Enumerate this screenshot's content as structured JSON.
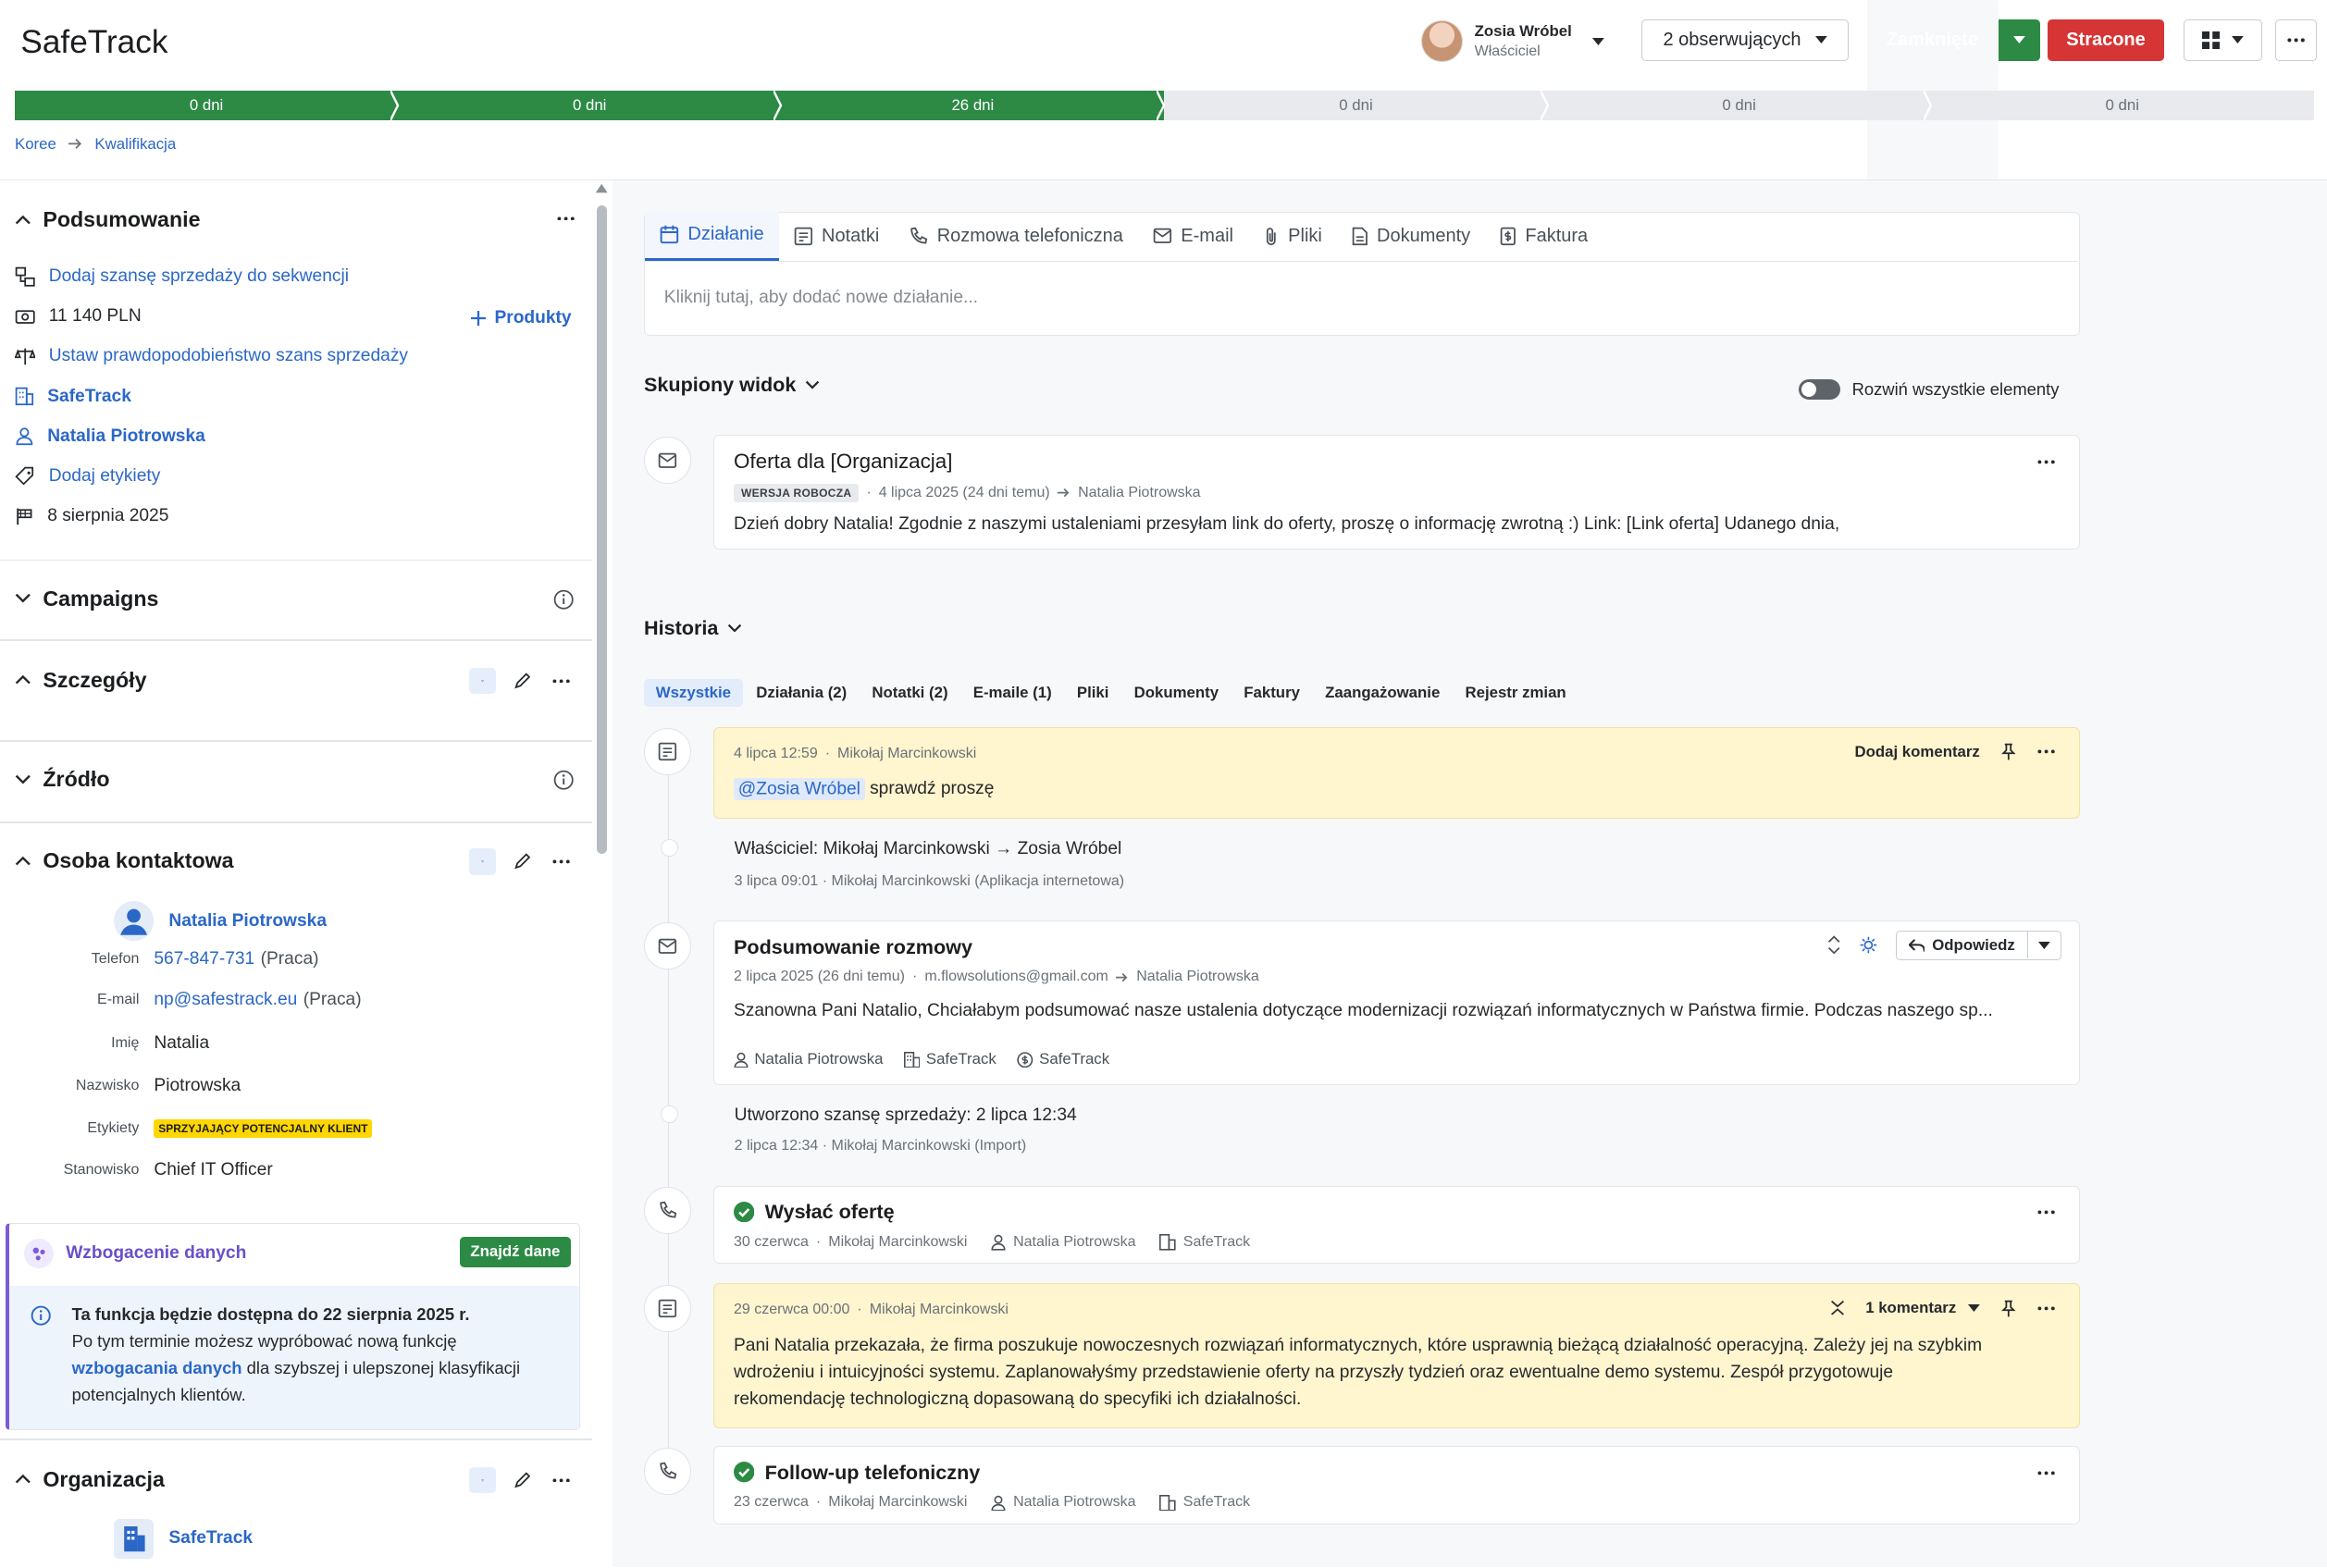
{
  "header": {
    "app_title": "SafeTrack",
    "owner_name": "Zosia Wróbel",
    "owner_role": "Właściciel",
    "watchers_label": "2 obserwujących",
    "won_label": "Zamknięte",
    "lost_label": "Stracone"
  },
  "pipeline": {
    "stages": [
      {
        "label": "0 dni",
        "state": "done"
      },
      {
        "label": "0 dni",
        "state": "done"
      },
      {
        "label": "26 dni",
        "state": "done"
      },
      {
        "label": "0 dni",
        "state": "todo"
      },
      {
        "label": "0 dni",
        "state": "todo"
      },
      {
        "label": "0 dni",
        "state": "todo"
      }
    ]
  },
  "breadcrumb": {
    "pipeline": "Koree",
    "stage": "Kwalifikacja"
  },
  "sidebar": {
    "summary": {
      "title": "Podsumowanie",
      "add_sequence": "Dodaj szansę sprzedaży do sekwencji",
      "value": "11 140 PLN",
      "products": "Produkty",
      "probability": "Ustaw prawdopodobieństwo szans sprzedaży",
      "organization": "SafeTrack",
      "person": "Natalia Piotrowska",
      "labels": "Dodaj etykiety",
      "close_date": "8 sierpnia 2025"
    },
    "campaigns_title": "Campaigns",
    "details_title": "Szczegóły",
    "source_title": "Źródło",
    "contact": {
      "title": "Osoba kontaktowa",
      "name": "Natalia Piotrowska",
      "phone_label": "Telefon",
      "phone": "567-847-731",
      "phone_type": "(Praca)",
      "email_label": "E-mail",
      "email": "np@safestrack.eu",
      "email_type": "(Praca)",
      "first_name_label": "Imię",
      "first_name": "Natalia",
      "last_name_label": "Nazwisko",
      "last_name": "Piotrowska",
      "tags_label": "Etykiety",
      "tag": "SPRZYJAJĄCY POTENCJALNY KLIENT",
      "position_label": "Stanowisko",
      "position": "Chief IT Officer"
    },
    "enrichment": {
      "title": "Wzbogacenie danych",
      "button": "Znajdź dane",
      "headline": "Ta funkcja będzie dostępna do 22 sierpnia 2025 r.",
      "text_before": "Po tym terminie możesz wypróbować nową funkcję",
      "link": "wzbogacania danych",
      "text_after": " dla szybszej i ulepszonej klasyfikacji potencjalnych klientów."
    },
    "organization": {
      "title": "Organizacja",
      "name": "SafeTrack"
    }
  },
  "composer": {
    "tabs": [
      "Działanie",
      "Notatki",
      "Rozmowa telefoniczna",
      "E-mail",
      "Pliki",
      "Dokumenty",
      "Faktura"
    ],
    "placeholder": "Kliknij tutaj, aby dodać nowe działanie..."
  },
  "focus": {
    "title": "Skupiony widok",
    "expand_all": "Rozwiń wszystkie elementy",
    "email": {
      "title": "Oferta dla [Organizacja]",
      "draft": "WERSJA ROBOCZA",
      "date": "4 lipca 2025 (24 dni temu)",
      "to": "Natalia Piotrowska",
      "body": "Dzień dobry Natalia! Zgodnie z naszymi ustaleniami przesyłam link do oferty, proszę o informację zwrotną :) Link: [Link oferta] Udanego dnia,"
    }
  },
  "history": {
    "title": "Historia",
    "filters": [
      "Wszystkie",
      "Działania (2)",
      "Notatki (2)",
      "E-maile (1)",
      "Pliki",
      "Dokumenty",
      "Faktury",
      "Zaangażowanie",
      "Rejestr zmian"
    ],
    "note1": {
      "meta_date": "4 lipca 12:59",
      "meta_author": "Mikołaj Marcinkowski",
      "add_comment": "Dodaj komentarz",
      "mention": "@Zosia Wróbel",
      "text": " sprawdź proszę"
    },
    "owner_change": {
      "text": "Właściciel: Mikołaj Marcinkowski → Zosia Wróbel",
      "meta": "3 lipca 09:01 · Mikołaj Marcinkowski (Aplikacja internetowa)"
    },
    "email2": {
      "title": "Podsumowanie rozmowy",
      "date": "2 lipca 2025 (26 dni temu)",
      "from": "m.flowsolutions@gmail.com",
      "to": "Natalia Piotrowska",
      "reply": "Odpowiedz",
      "body": "Szanowna Pani Natalio, Chciałabym podsumować nasze ustalenia dotyczące modernizacji rozwiązań informatycznych w Państwa firmie. Podczas naszego sp...",
      "chips": [
        "Natalia Piotrowska",
        "SafeTrack",
        "SafeTrack"
      ]
    },
    "deal_created": {
      "text": "Utworzono szansę sprzedaży: 2 lipca 12:34",
      "meta": "2 lipca 12:34 · Mikołaj Marcinkowski (Import)"
    },
    "activity1": {
      "title": "Wysłać ofertę",
      "date": "30 czerwca",
      "author": "Mikołaj Marcinkowski",
      "person": "Natalia Piotrowska",
      "org": "SafeTrack"
    },
    "note2": {
      "meta_date": "29 czerwca 00:00",
      "meta_author": "Mikołaj Marcinkowski",
      "comments": "1 komentarz",
      "line1": "Pani Natalia przekazała, że firma poszukuje nowoczesnych rozwiązań informatycznych, które usprawnią bieżącą działalność operacyjną. Zależy jej na szybkim",
      "line2": "wdrożeniu i intuicyjności systemu. Zaplanowałyśmy przedstawienie oferty na przyszły tydzień oraz ewentualne demo systemu. Zespół przygotowuje",
      "line3": "rekomendację technologiczną dopasowaną do specyfiki ich działalności."
    },
    "activity2": {
      "title": "Follow-up telefoniczny",
      "date": "23 czerwca",
      "author": "Mikołaj Marcinkowski",
      "person": "Natalia Piotrowska",
      "org": "SafeTrack"
    }
  },
  "colors": {
    "accent": "#2b67c7",
    "won": "#2c8a44",
    "lost": "#d63535",
    "note": "#fff5cf"
  }
}
